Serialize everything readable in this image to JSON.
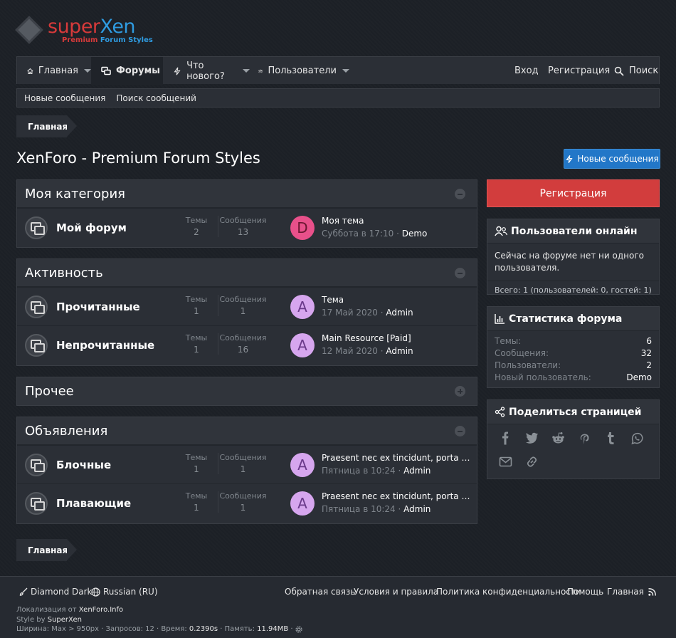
{
  "logo": {
    "part1": "super",
    "part2": "Xen",
    "tag1": "Premium",
    "tag2": "Forum Styles"
  },
  "nav": {
    "home": "Главная",
    "forums": "Форумы",
    "whats_new": "Что нового?",
    "members": "Пользователи",
    "login": "Вход",
    "register": "Регистрация",
    "search": "Поиск"
  },
  "subnav": {
    "new_posts": "Новые сообщения",
    "search_posts": "Поиск сообщений"
  },
  "breadcrumb": {
    "home": "Главная"
  },
  "page": {
    "title": "XenForo - Premium Forum Styles",
    "new_posts_button": "Новые сообщения"
  },
  "categories": [
    {
      "title": "Моя категория",
      "collapsed": false,
      "nodes": [
        {
          "title": "Мой форум",
          "threads_label": "Темы",
          "threads": "2",
          "messages_label": "Сообщения",
          "messages": "13",
          "avatar": "D",
          "avatar_color": "#e8508a",
          "avatar_text_color": "#6a1630",
          "last_title": "Моя тема",
          "last_date": "Суббота в 17:10",
          "last_user": "Demo"
        }
      ]
    },
    {
      "title": "Активность",
      "collapsed": false,
      "nodes": [
        {
          "title": "Прочитанные",
          "threads_label": "Темы",
          "threads": "1",
          "messages_label": "Сообщения",
          "messages": "1",
          "avatar": "A",
          "avatar_color": "#d6a6ee",
          "avatar_text_color": "#6a3a8a",
          "last_title": "Тема",
          "last_date": "17 Май 2020",
          "last_user": "Admin"
        },
        {
          "title": "Непрочитанные",
          "threads_label": "Темы",
          "threads": "1",
          "messages_label": "Сообщения",
          "messages": "16",
          "avatar": "A",
          "avatar_color": "#d6a6ee",
          "avatar_text_color": "#6a3a8a",
          "last_title": "Main Resource [Paid]",
          "last_date": "12 Май 2020",
          "last_user": "Admin"
        }
      ]
    },
    {
      "title": "Прочее",
      "collapsed": true,
      "nodes": []
    },
    {
      "title": "Объявления",
      "collapsed": false,
      "nodes": [
        {
          "title": "Блочные",
          "threads_label": "Темы",
          "threads": "1",
          "messages_label": "Сообщения",
          "messages": "1",
          "avatar": "A",
          "avatar_color": "#d6a6ee",
          "avatar_text_color": "#6a3a8a",
          "last_title": "Praesent nec ex tincidunt, porta turpis at, dictum ante",
          "last_date": "Пятница в 10:24",
          "last_user": "Admin"
        },
        {
          "title": "Плавающие",
          "threads_label": "Темы",
          "threads": "1",
          "messages_label": "Сообщения",
          "messages": "1",
          "avatar": "A",
          "avatar_color": "#d6a6ee",
          "avatar_text_color": "#6a3a8a",
          "last_title": "Praesent nec ex tincidunt, porta turpis at, dictum ante",
          "last_date": "Пятница в 10:24",
          "last_user": "Admin"
        }
      ]
    }
  ],
  "sidebar": {
    "register_button": "Регистрация",
    "online": {
      "title": "Пользователи онлайн",
      "body": "Сейчас на форуме нет ни одного пользователя.",
      "footer": "Всего: 1 (пользователей: 0, гостей: 1)"
    },
    "stats": {
      "title": "Статистика форума",
      "rows": [
        {
          "k": "Темы:",
          "v": "6"
        },
        {
          "k": "Сообщения:",
          "v": "32"
        },
        {
          "k": "Пользователи:",
          "v": "2"
        },
        {
          "k": "Новый пользователь:",
          "v": "Demo"
        }
      ]
    },
    "share": {
      "title": "Поделиться страницей",
      "icons": [
        "facebook-icon",
        "twitter-icon",
        "reddit-icon",
        "pinterest-icon",
        "tumblr-icon",
        "whatsapp-icon",
        "email-icon",
        "link-icon"
      ]
    }
  },
  "footer": {
    "style": "Diamond Dark",
    "language": "Russian (RU)",
    "links": [
      "Обратная связь",
      "Условия и правила",
      "Политика конфиденциальности",
      "Помощь",
      "Главная"
    ],
    "localization_prefix": "Локализация от",
    "localization_link": "XenForo.Info",
    "style_prefix": "Style by",
    "style_link": "SuperXen",
    "debug_width": "Ширина: Max > 950px · Запросов: 12 · Время:",
    "debug_time": "0.2390s",
    "debug_mem_label": "· Память:",
    "debug_mem": "11.94MB"
  }
}
